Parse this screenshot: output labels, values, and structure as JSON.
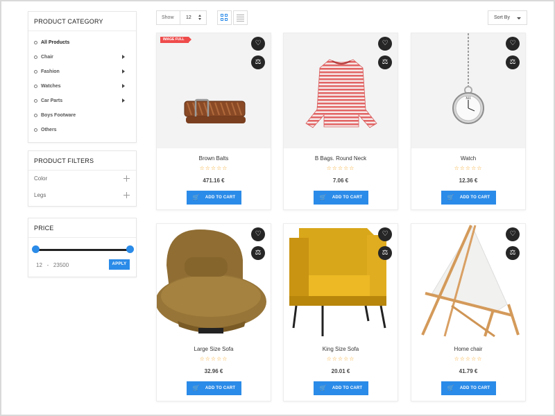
{
  "sidebar": {
    "category_title": "PRODUCT CATEGORY",
    "categories": [
      {
        "label": "All Products",
        "active": true,
        "has_submenu": false
      },
      {
        "label": "Chair",
        "active": false,
        "has_submenu": true
      },
      {
        "label": "Fashion",
        "active": false,
        "has_submenu": true
      },
      {
        "label": "Watches",
        "active": false,
        "has_submenu": true
      },
      {
        "label": "Car Parts",
        "active": false,
        "has_submenu": true
      },
      {
        "label": "Boys Footware",
        "active": false,
        "has_submenu": false
      },
      {
        "label": "Others",
        "active": false,
        "has_submenu": false
      }
    ],
    "filters_title": "PRODUCT FILTERS",
    "filters": [
      {
        "label": "Color",
        "icon": "plus-icon"
      },
      {
        "label": "Legs",
        "icon": "plus-icon"
      }
    ],
    "price_title": "PRICE",
    "price_min": "12",
    "price_sep": "-",
    "price_max": "23500",
    "apply_label": "APPLY"
  },
  "toolbar": {
    "show_label": "Show",
    "show_value": "12",
    "sort_label": "Sort By",
    "grid_icon": "grid-view-icon",
    "list_icon": "list-view-icon"
  },
  "colors": {
    "accent": "#2b8be8",
    "badge": "#ef4b4b",
    "star": "#f5a623",
    "dark_button": "#262626"
  },
  "products": [
    {
      "name": "Brown Balts",
      "price": "471.16 €",
      "stars": "☆☆☆☆☆",
      "badge": "IMAGE FULL",
      "cart_label": "ADD TO CART",
      "image_icon": "belt-image"
    },
    {
      "name": "B Bags. Round Neck",
      "price": "7.06 €",
      "stars": "☆☆☆☆☆",
      "badge": "",
      "cart_label": "ADD TO CART",
      "image_icon": "striped-top-image"
    },
    {
      "name": "Watch",
      "price": "12.36 €",
      "stars": "☆☆☆☆☆",
      "badge": "",
      "cart_label": "ADD TO CART",
      "image_icon": "pocket-watch-image"
    },
    {
      "name": "Large Size Sofa",
      "price": "32.96 €",
      "stars": "☆☆☆☆☆",
      "badge": "",
      "cart_label": "ADD TO CART",
      "image_icon": "armchair-image"
    },
    {
      "name": "King Size Sofa",
      "price": "20.01 €",
      "stars": "☆☆☆☆☆",
      "badge": "",
      "cart_label": "ADD TO CART",
      "image_icon": "yellow-armchair-image"
    },
    {
      "name": "Home chair",
      "price": "41.79 €",
      "stars": "☆☆☆☆☆",
      "badge": "",
      "cart_label": "ADD TO CART",
      "image_icon": "deck-chair-image"
    }
  ]
}
